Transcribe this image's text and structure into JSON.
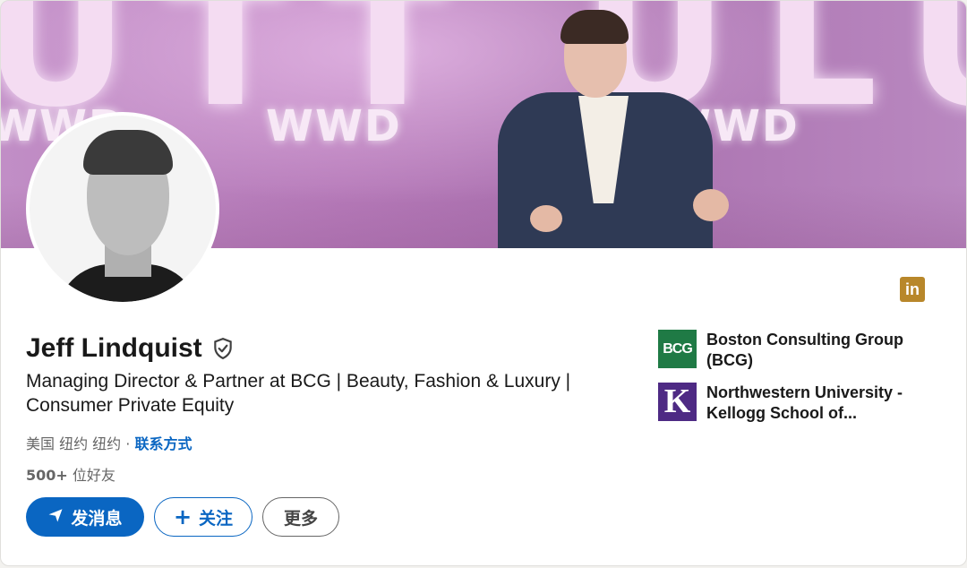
{
  "banner": {
    "big_text": "UTT ULU",
    "logo_text": "WWD"
  },
  "profile": {
    "name": "Jeff Lindquist",
    "headline": "Managing Director & Partner at BCG | Beauty, Fashion & Luxury | Consumer Private Equity",
    "location": "美国 纽约 纽约 · ",
    "contact_info": "联系方式",
    "connections_count": "500+",
    "connections_label": " 位好友"
  },
  "badge": {
    "label": "in",
    "color": "#b8872a"
  },
  "actions": {
    "message_label": "发消息",
    "follow_label": "关注",
    "more_label": "更多"
  },
  "orgs": [
    {
      "logo_text": "BCG",
      "name": "Boston Consulting Group (BCG)"
    },
    {
      "logo_text": "K",
      "name": "Northwestern University - Kellogg School of..."
    }
  ],
  "colors": {
    "primary": "#0a66c2",
    "bcg_green": "#1f7a45",
    "kellogg_purple": "#4e2a84"
  }
}
